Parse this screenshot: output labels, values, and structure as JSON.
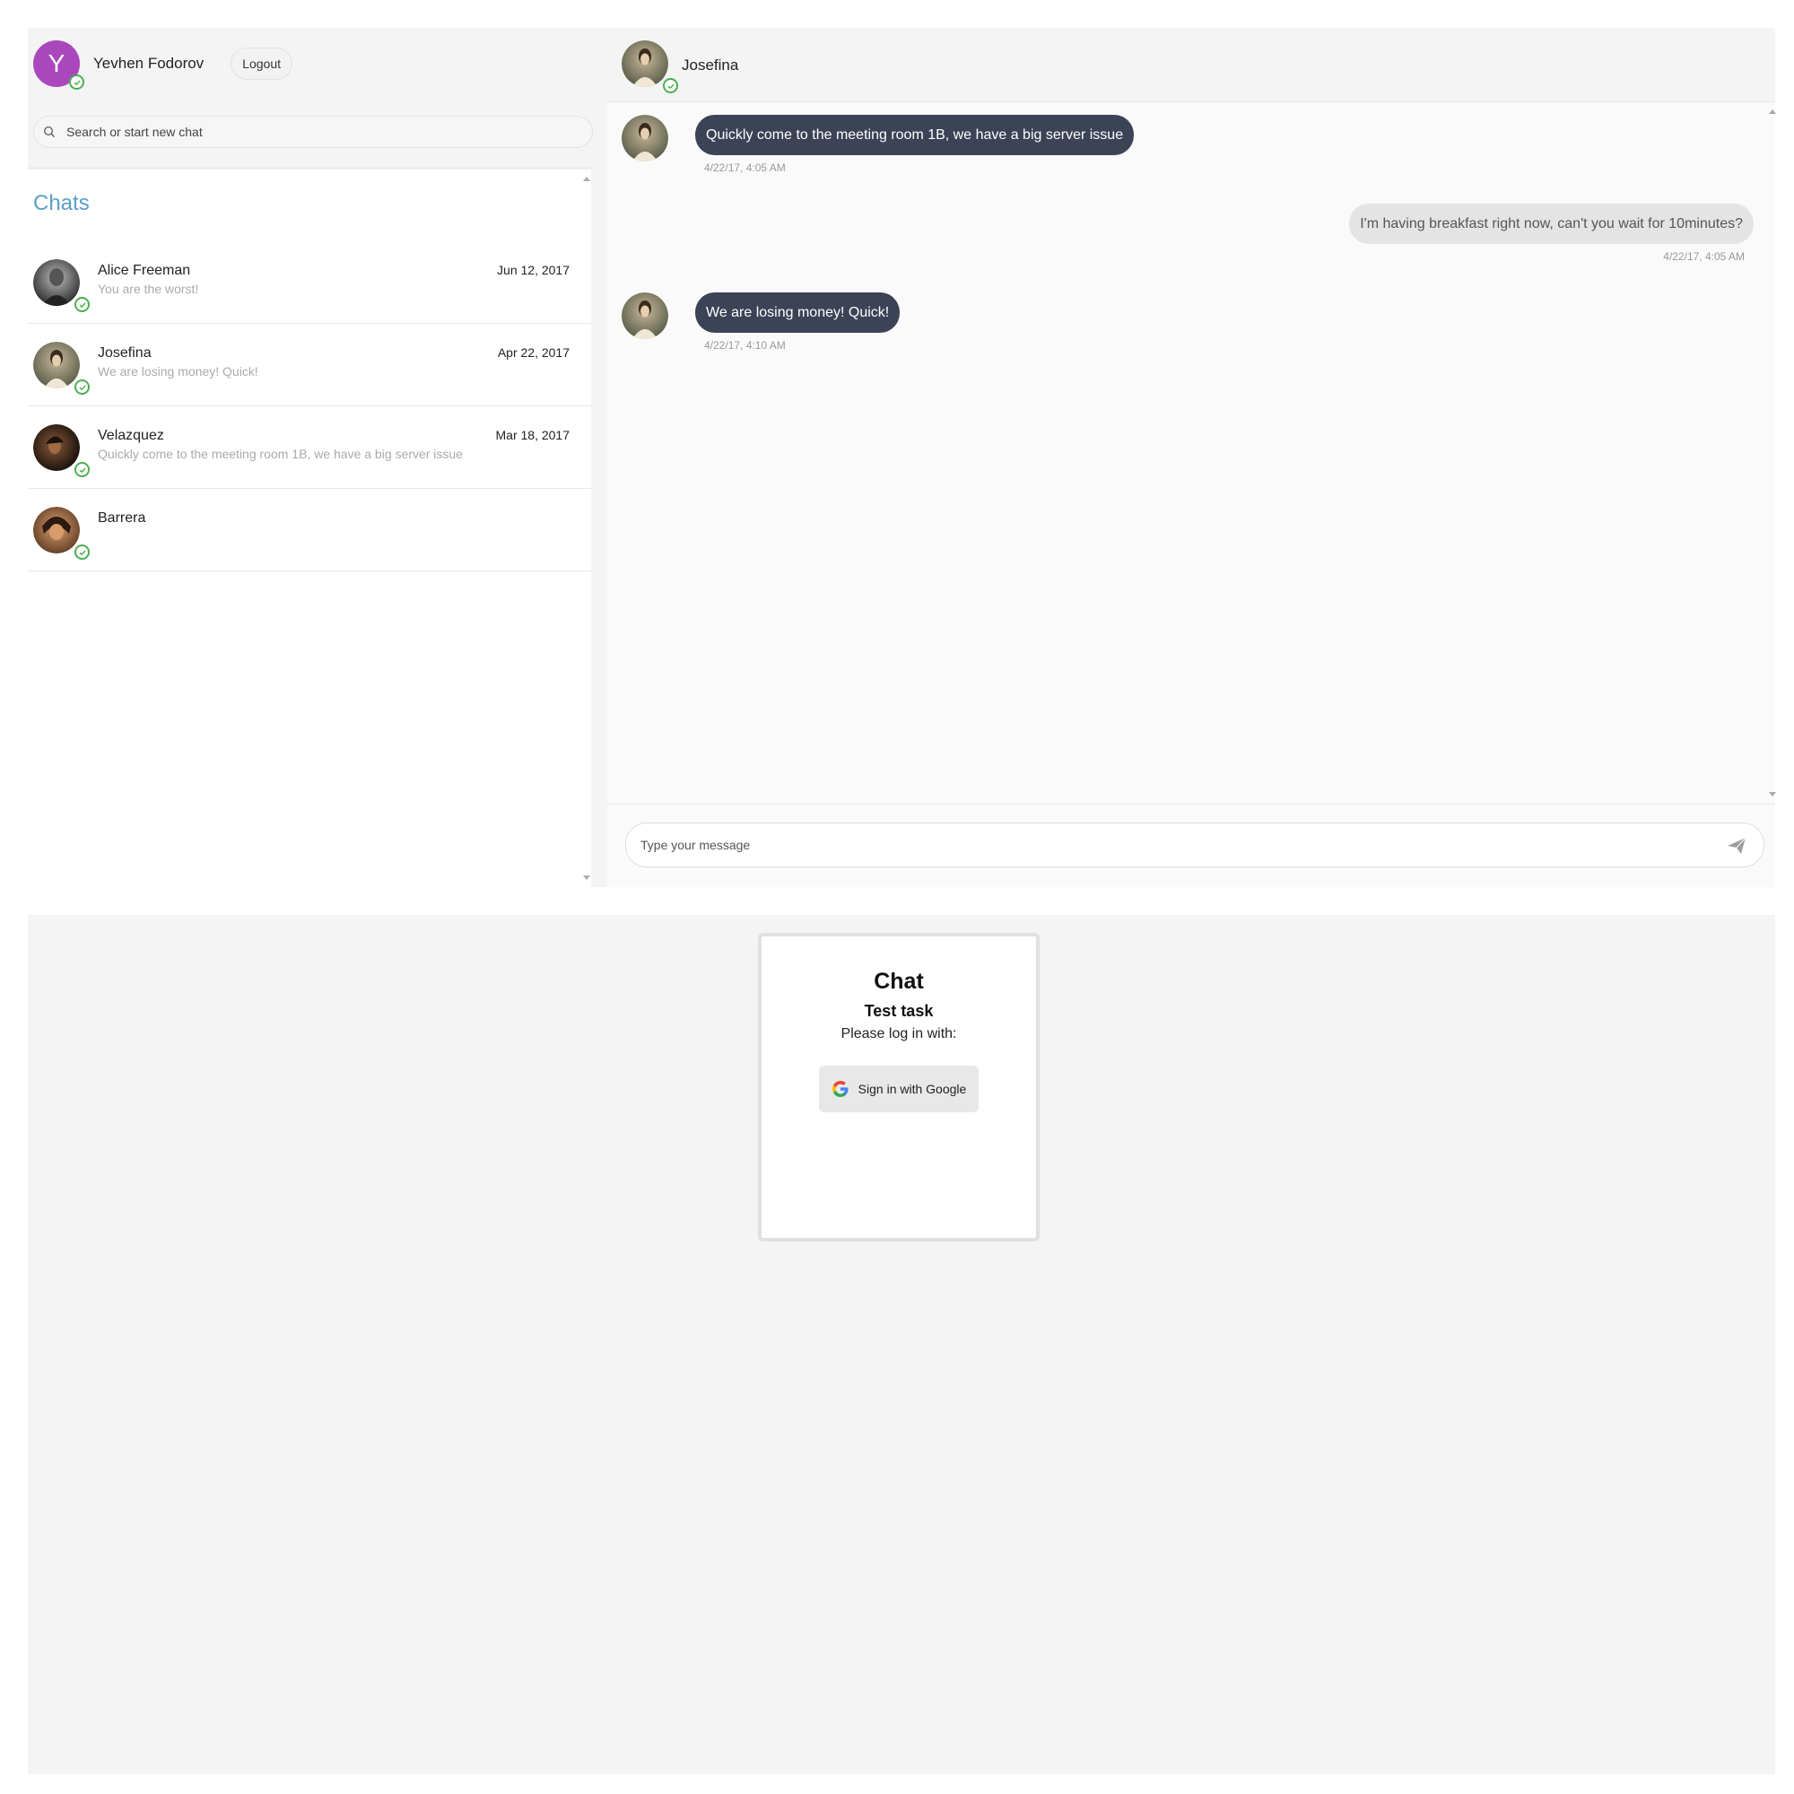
{
  "user": {
    "initial": "Y",
    "name": "Yevhen Fodorov",
    "logout_label": "Logout"
  },
  "search": {
    "placeholder": "Search or start new chat"
  },
  "chats_title": "Chats",
  "chats": [
    {
      "name": "Alice Freeman",
      "last": "You are the worst!",
      "date": "Jun 12, 2017"
    },
    {
      "name": "Josefina",
      "last": "We are losing money! Quick!",
      "date": "Apr 22, 2017"
    },
    {
      "name": "Velazquez",
      "last": "Quickly come to the meeting room 1B, we have a big server issue",
      "date": "Mar 18, 2017"
    },
    {
      "name": "Barrera",
      "last": "",
      "date": ""
    }
  ],
  "active_chat": {
    "name": "Josefina",
    "messages": [
      {
        "text": "Quickly come to the meeting room 1B, we have a big server issue",
        "time": "4/22/17, 4:05 AM"
      },
      {
        "text": "I'm having breakfast right now, can't you wait for 10minutes?",
        "time": "4/22/17, 4:05 AM"
      },
      {
        "text": "We are losing money! Quick!",
        "time": "4/22/17, 4:10 AM"
      }
    ]
  },
  "composer": {
    "placeholder": "Type your message"
  },
  "login": {
    "title": "Chat",
    "subtitle": "Test task",
    "note": "Please log in with:",
    "google_label": "Sign in with Google"
  },
  "colors": {
    "avatar_bg": "#ab47bc",
    "incoming_bubble": "#3c4356",
    "outgoing_bubble": "#e4e4e4",
    "chats_title": "#5b9fc9",
    "online": "#4caf50"
  }
}
